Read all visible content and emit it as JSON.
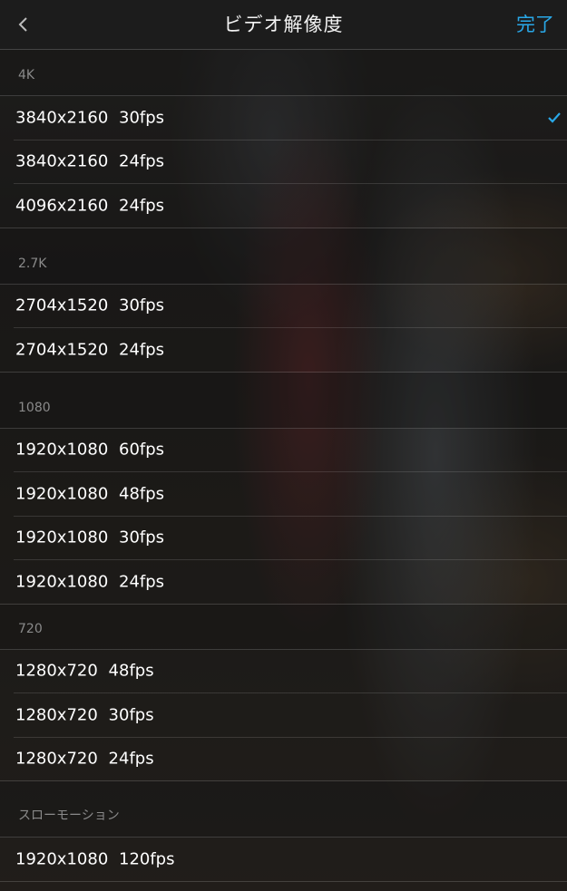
{
  "header": {
    "title": "ビデオ解像度",
    "done_label": "完了",
    "back_icon": "chevron-left-icon"
  },
  "colors": {
    "accent": "#29a8e8",
    "section_text": "#8a8a8a",
    "item_text": "#ffffff"
  },
  "sections": [
    {
      "label": "4K",
      "items": [
        {
          "label": "3840x2160  30fps",
          "selected": true
        },
        {
          "label": "3840x2160  24fps",
          "selected": false
        },
        {
          "label": "4096x2160  24fps",
          "selected": false
        }
      ]
    },
    {
      "label": "2.7K",
      "items": [
        {
          "label": "2704x1520  30fps",
          "selected": false
        },
        {
          "label": "2704x1520  24fps",
          "selected": false
        }
      ]
    },
    {
      "label": "1080",
      "items": [
        {
          "label": "1920x1080  60fps",
          "selected": false
        },
        {
          "label": "1920x1080  48fps",
          "selected": false
        },
        {
          "label": "1920x1080  30fps",
          "selected": false
        },
        {
          "label": "1920x1080  24fps",
          "selected": false
        }
      ]
    },
    {
      "label": "720",
      "items": [
        {
          "label": "1280x720  48fps",
          "selected": false
        },
        {
          "label": "1280x720  30fps",
          "selected": false
        },
        {
          "label": "1280x720  24fps",
          "selected": false
        }
      ]
    },
    {
      "label": "スローモーション",
      "items": [
        {
          "label": "1920x1080  120fps",
          "selected": false
        }
      ]
    }
  ]
}
